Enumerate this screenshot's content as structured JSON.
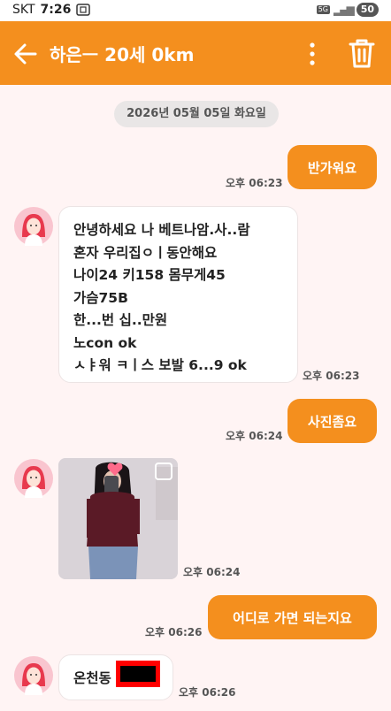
{
  "status_bar": {
    "carrier": "SKT",
    "time": "7:26",
    "network": "5G",
    "battery": "50"
  },
  "header": {
    "title": "하은ㅡ 20세 0km"
  },
  "date_chip": "2026년 05월 05일 화요일",
  "messages": [
    {
      "direction": "outgoing",
      "text": "반가워요",
      "time": "오후 06:23"
    },
    {
      "direction": "incoming",
      "text": "안녕하세요 나 베트나암.사..람\n혼자 우리집ㅇㅣ동안해요\n나이24 키158 몸무게45\n가슴75B\n한...번 십..만원\n노con ok\nㅅㅑ워 ㅋㅣ스 보발 6...9 ok",
      "time": "오후 06:23"
    },
    {
      "direction": "outgoing",
      "text": "사진좀요",
      "time": "오후 06:24"
    },
    {
      "direction": "incoming",
      "type": "photo",
      "time": "오후 06:24"
    },
    {
      "direction": "outgoing",
      "text": "어디로 가면 되는지요",
      "time": "오후 06:26"
    },
    {
      "direction": "incoming",
      "text": "온천동",
      "time": "오후 06:26"
    }
  ],
  "colors": {
    "accent": "#f48f1e",
    "background": "#fff4f4",
    "bubble_in": "#ffffff",
    "redaction": "#ff0000"
  }
}
